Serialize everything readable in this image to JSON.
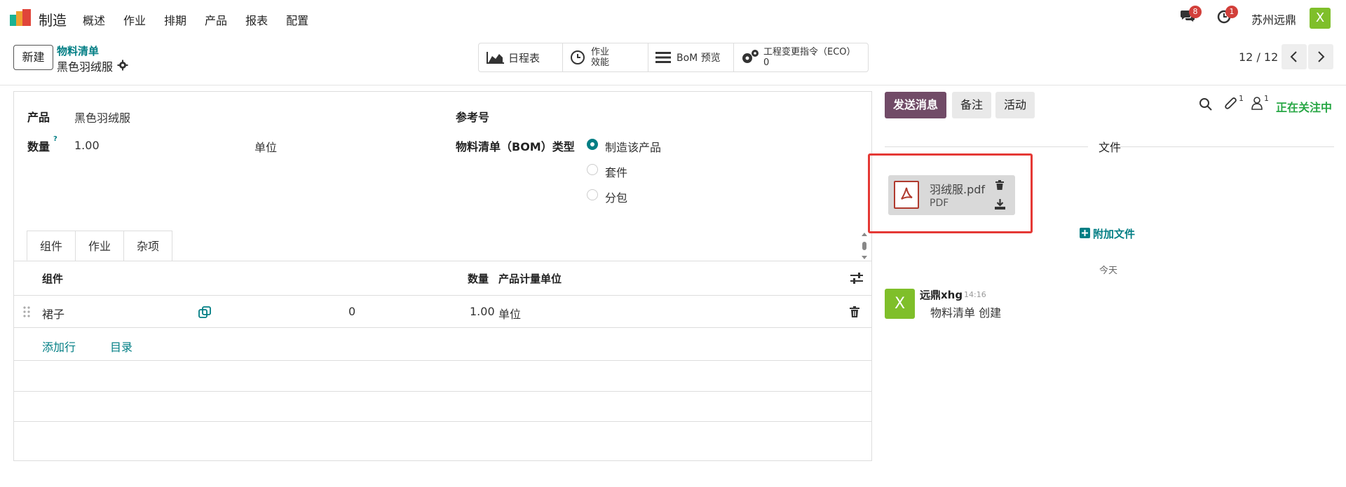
{
  "navbar": {
    "app_name": "制造",
    "menu": [
      "概述",
      "作业",
      "排期",
      "产品",
      "报表",
      "配置"
    ],
    "messages_badge": "8",
    "activities_badge": "1",
    "company": "苏州远鼎",
    "avatar_letter": "X"
  },
  "control_panel": {
    "new_label": "新建",
    "breadcrumb_parent": "物料清单",
    "breadcrumb_current": "黑色羽绒服",
    "smart_buttons": {
      "schedule": "日程表",
      "efficiency_line1": "作业",
      "efficiency_line2": "效能",
      "bom_preview": "BoM 预览",
      "eco_label": "工程变更指令（ECO）",
      "eco_count": "0"
    },
    "pager": "12 / 12"
  },
  "form": {
    "product_label": "产品",
    "product_value": "黑色羽绒服",
    "reference_label": "参考号",
    "quantity_label": "数量",
    "quantity_help": "?",
    "quantity_value": "1.00",
    "uom_value": "单位",
    "bom_type_label": "物料清单（BOM）类型",
    "bom_types": [
      "制造该产品",
      "套件",
      "分包"
    ],
    "tabs": [
      "组件",
      "作业",
      "杂项"
    ],
    "table": {
      "col_component": "组件",
      "col_quantity": "数量",
      "col_uom": "产品计量单位",
      "rows": [
        {
          "component": "裙子",
          "variant_count": "0",
          "quantity": "1.00",
          "uom": "单位"
        }
      ],
      "add_line": "添加行",
      "catalog": "目录"
    }
  },
  "chatter": {
    "send_message": "发送消息",
    "log_note": "备注",
    "activity": "活动",
    "attachment_count": "1",
    "follower_count": "1",
    "following": "正在关注中",
    "files_title": "文件",
    "attachment_name": "羽绒服.pdf",
    "attachment_type": "PDF",
    "attach_file": "附加文件",
    "today": "今天",
    "message": {
      "avatar_letter": "X",
      "author": "远鼎xhg",
      "time": "14:16",
      "body": "物料清单 创建"
    }
  },
  "colors": {
    "brand": "#714b67",
    "accent": "#017e84",
    "badge": "#d23f3a",
    "highlight_box": "#e53935",
    "avatar": "#7fbf2a",
    "following": "#28a745"
  }
}
